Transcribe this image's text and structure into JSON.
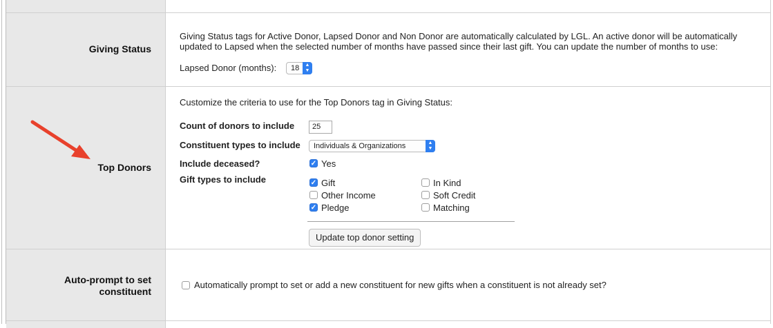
{
  "giving_status": {
    "label": "Giving Status",
    "description": "Giving Status tags for Active Donor, Lapsed Donor and Non Donor are automatically calculated by LGL. An active donor will be automatically updated to Lapsed when the selected number of months have passed since their last gift. You can update the number of months to use:",
    "lapsed_label": "Lapsed Donor (months):",
    "lapsed_value": "18"
  },
  "top_donors": {
    "label": "Top Donors",
    "intro": "Customize the criteria to use for the Top Donors tag in Giving Status:",
    "count_label": "Count of donors to include",
    "count_value": "25",
    "types_label": "Constituent types to include",
    "types_value": "Individuals & Organizations",
    "deceased_label": "Include deceased?",
    "deceased_option": "Yes",
    "deceased_checked": true,
    "gift_types_label": "Gift types to include",
    "gift_types": [
      {
        "label": "Gift",
        "checked": true
      },
      {
        "label": "Other Income",
        "checked": false
      },
      {
        "label": "Pledge",
        "checked": true
      },
      {
        "label": "In Kind",
        "checked": false
      },
      {
        "label": "Soft Credit",
        "checked": false
      },
      {
        "label": "Matching",
        "checked": false
      }
    ],
    "update_button": "Update top donor setting"
  },
  "auto_prompt": {
    "label_line1": "Auto-prompt to set",
    "label_line2": "constituent",
    "checkbox_label": "Automatically prompt to set or add a new constituent for new gifts when a constituent is not already set?",
    "checked": false
  },
  "colors": {
    "accent": "#2f7ff0",
    "label_bg": "#e8e8e8",
    "annotation_arrow": "#e8412c"
  }
}
